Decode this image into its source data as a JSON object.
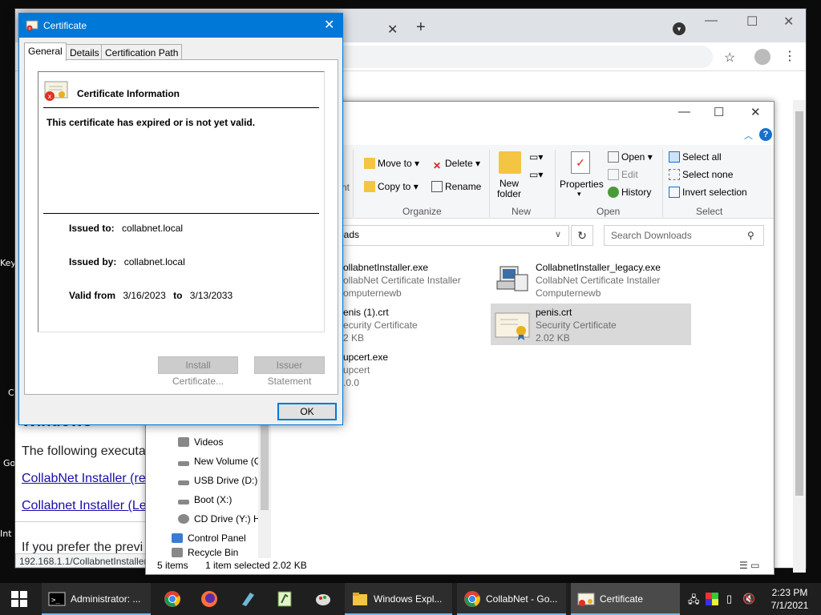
{
  "desktop": {
    "labels": [
      "Key",
      "C",
      "Go",
      "Int"
    ]
  },
  "chrome": {
    "tab_close": "✕",
    "new_tab": "+",
    "minimize": "—",
    "maximize": "☐",
    "close": "✕",
    "star": "☆",
    "menu": "⋮",
    "page": {
      "heading": "Windows",
      "paragraph": "The following executa",
      "link1": "CollabNet Installer (re",
      "link2": "Collabnet Installer (Le",
      "paragraph2": "If you prefer the previ",
      "status_url": "192.168.1.1/CollabnetInstaller_"
    }
  },
  "explorer": {
    "minimize": "—",
    "maximize": "☐",
    "close": "✕",
    "help": "?",
    "ribbon": {
      "move_to": "Move to",
      "copy_to": "Copy to",
      "delete": "Delete",
      "rename": "Rename",
      "new_folder_line1": "New",
      "new_folder_line2": "folder",
      "properties": "Properties",
      "open": "Open",
      "edit": "Edit",
      "history": "History",
      "select_all": "Select all",
      "select_none": "Select none",
      "invert_selection": "Invert selection",
      "partial_label": "nt",
      "groups": {
        "organize": "Organize",
        "new": "New",
        "open": "Open",
        "select": "Select"
      }
    },
    "address": "oads",
    "search_placeholder": "Search Downloads",
    "nav": [
      {
        "label": "Videos"
      },
      {
        "label": "New Volume (C"
      },
      {
        "label": "USB Drive (D:)"
      },
      {
        "label": "Boot (X:)"
      },
      {
        "label": "CD Drive (Y:) H"
      },
      {
        "label": "Control Panel"
      },
      {
        "label": "Recycle Bin"
      }
    ],
    "files": [
      {
        "name": "ollabnetInstaller.exe",
        "desc": "ollabNet Certificate Installer",
        "size": "omputernewb"
      },
      {
        "name": "CollabnetInstaller_legacy.exe",
        "desc": "CollabNet Certificate Installer",
        "size": "Computernewb"
      },
      {
        "name": "enis (1).crt",
        "desc": "ecurity Certificate",
        "size": "2 KB"
      },
      {
        "name": "penis.crt",
        "desc": "Security Certificate",
        "size": "2.02 KB"
      },
      {
        "name": "upcert.exe",
        "desc": "upcert",
        "size": ".0.0"
      }
    ],
    "status": {
      "items": "5 items",
      "selected": "1 item selected",
      "size": "2.02 KB"
    }
  },
  "certificate": {
    "title": "Certificate",
    "close": "✕",
    "tabs": [
      "General",
      "Details",
      "Certification Path"
    ],
    "heading": "Certificate Information",
    "message": "This certificate has expired or is not yet valid.",
    "issued_to_label": "Issued to:",
    "issued_to": "collabnet.local",
    "issued_by_label": "Issued by:",
    "issued_by": "collabnet.local",
    "valid_from_label": "Valid from",
    "valid_from": "3/16/2023",
    "to_label": "to",
    "valid_to": "3/13/2033",
    "install_button": "Install Certificate...",
    "issuer_button": "Issuer Statement",
    "ok_button": "OK"
  },
  "taskbar": {
    "items": [
      {
        "label": "Administrator: ..."
      },
      {
        "label": "Windows Expl..."
      },
      {
        "label": "CollabNet - Go..."
      },
      {
        "label": "Certificate"
      }
    ],
    "time": "2:23 PM",
    "date": "7/1/2021"
  },
  "colors": {
    "accent": "#0078d7",
    "taskbar": "#1f1f1f"
  }
}
